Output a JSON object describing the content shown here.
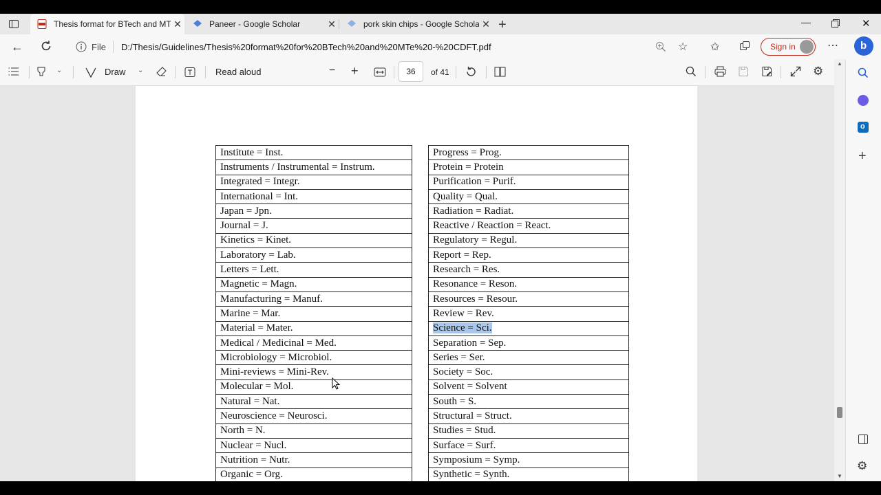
{
  "tabs": [
    {
      "title": "Thesis format for BTech and MTe",
      "active": true
    },
    {
      "title": "Paneer - Google Scholar",
      "active": false
    },
    {
      "title": "pork skin chips - Google Scholar",
      "active": false
    }
  ],
  "address": {
    "label": "File",
    "url": "D:/Thesis/Guidelines/Thesis%20format%20for%20BTech%20and%20MTe%20-%20CDFT.pdf",
    "signin": "Sign in"
  },
  "pdf_toolbar": {
    "draw_label": "Draw",
    "read_aloud_label": "Read aloud",
    "page_number": "36",
    "page_total": "of 41"
  },
  "table_left": [
    "Institute = Inst.",
    "Instruments / Instrumental = Instrum.",
    "Integrated = Integr.",
    "International = Int.",
    "Japan = Jpn.",
    "Journal = J.",
    "Kinetics = Kinet.",
    "Laboratory = Lab.",
    "Letters = Lett.",
    "Magnetic = Magn.",
    "Manufacturing = Manuf.",
    "Marine = Mar.",
    "Material = Mater.",
    "Medical / Medicinal = Med.",
    "Microbiology = Microbiol.",
    "Mini-reviews = Mini-Rev.",
    "Molecular = Mol.",
    "Natural = Nat.",
    "Neuroscience = Neurosci.",
    "North = N.",
    "Nuclear = Nucl.",
    "Nutrition = Nutr.",
    "Organic = Org."
  ],
  "table_right": [
    "Progress = Prog.",
    "Protein = Protein",
    "Purification = Purif.",
    "Quality = Qual.",
    "Radiation = Radiat.",
    "Reactive / Reaction = React.",
    "Regulatory = Regul.",
    "Report = Rep.",
    "Research = Res.",
    "Resonance = Reson.",
    "Resources = Resour.",
    "Review = Rev.",
    "Science = Sci.",
    "Separation = Sep.",
    "Series = Ser.",
    "Society = Soc.",
    "Solvent = Solvent",
    "South = S.",
    "Structural = Struct.",
    "Studies = Stud.",
    "Surface = Surf.",
    "Symposium = Symp.",
    "Synthetic = Synth."
  ],
  "highlighted_right_row": 12,
  "colors": {
    "highlight": "#a9c7ea",
    "accent": "#c42b1c",
    "tab_bg": "#e8e8e8"
  }
}
